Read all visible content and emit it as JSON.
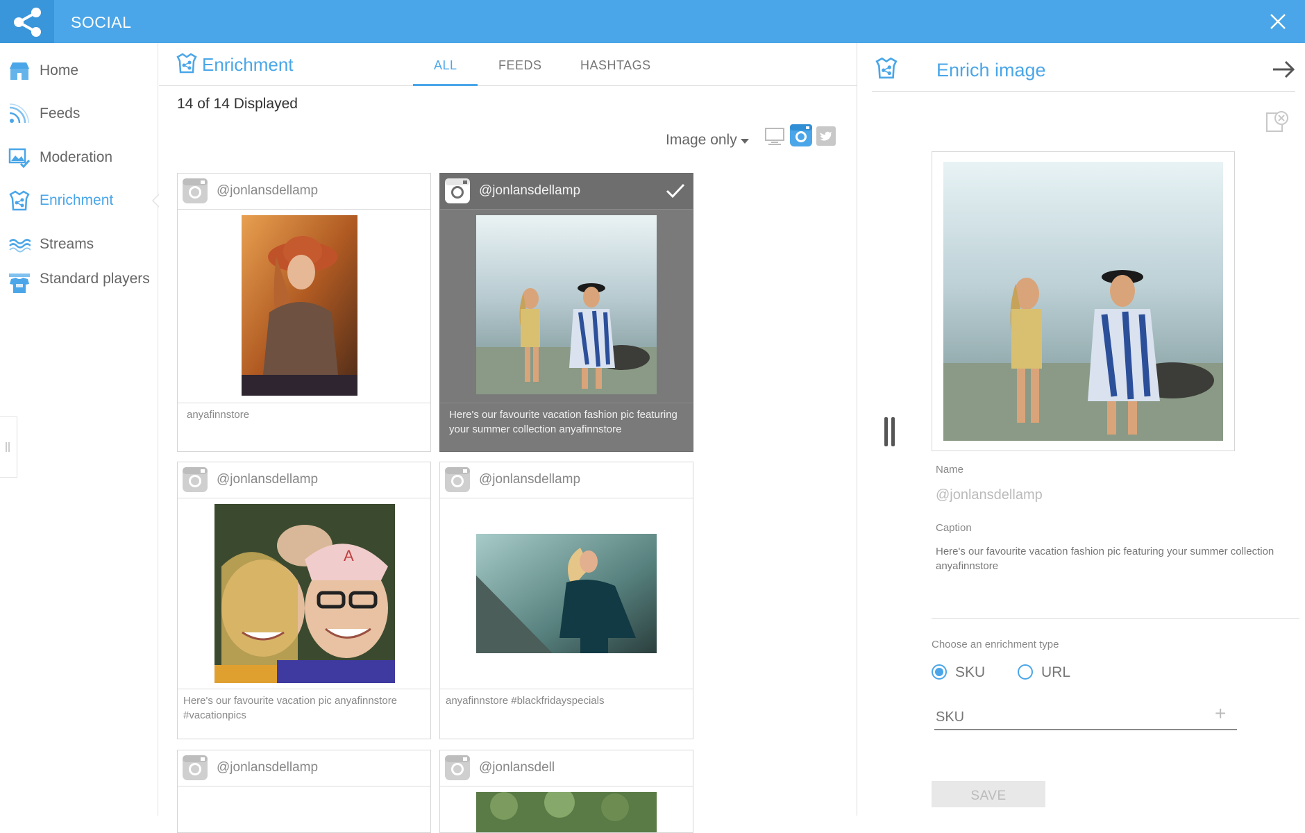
{
  "app": {
    "title": "SOCIAL"
  },
  "sidebar": {
    "items": [
      {
        "label": "Home",
        "icon": "home-store-icon",
        "active": false
      },
      {
        "label": "Feeds",
        "icon": "rss-feed-icon",
        "active": false
      },
      {
        "label": "Moderation",
        "icon": "image-check-icon",
        "active": false
      },
      {
        "label": "Enrichment",
        "icon": "enrichment-icon",
        "active": true
      },
      {
        "label": "Streams",
        "icon": "waves-icon",
        "active": false
      },
      {
        "label": "Standard players",
        "icon": "tshirt-icon",
        "active": false
      }
    ]
  },
  "enrichment": {
    "title": "Enrichment",
    "tabs": [
      {
        "label": "ALL",
        "active": true
      },
      {
        "label": "FEEDS",
        "active": false
      },
      {
        "label": "HASHTAGS",
        "active": false
      }
    ],
    "displayed": "14 of 14 Displayed",
    "filter": {
      "selected": "Image only"
    },
    "cards": [
      {
        "handle": "@jonlansdellamp",
        "caption": "anyafinnstore",
        "selected": false
      },
      {
        "handle": "@jonlansdellamp",
        "caption": "Here's our favourite vacation fashion pic featuring your summer collection anyafinnstore",
        "selected": true
      },
      {
        "handle": "@jonlansdellamp",
        "caption": "Here's our favourite vacation pic anyafinnstore #vacationpics",
        "selected": false
      },
      {
        "handle": "@jonlansdellamp",
        "caption": "anyafinnstore #blackfridayspecials",
        "selected": false
      },
      {
        "handle": "@jonlansdellamp",
        "caption": "",
        "selected": false
      },
      {
        "handle": "@jonlansdell",
        "caption": "",
        "selected": false
      }
    ]
  },
  "enrich_image": {
    "title": "Enrich image",
    "name_label": "Name",
    "name_value": "@jonlansdellamp",
    "caption_label": "Caption",
    "caption_value": "Here's our favourite vacation fashion pic featuring your summer collection anyafinnstore",
    "type_label": "Choose an enrichment type",
    "types": [
      {
        "label": "SKU",
        "checked": true
      },
      {
        "label": "URL",
        "checked": false
      }
    ],
    "sku_placeholder": "SKU",
    "save_label": "SAVE"
  },
  "colors": {
    "accent": "#4aa6e8",
    "selected_card": "#7a7a7a"
  }
}
